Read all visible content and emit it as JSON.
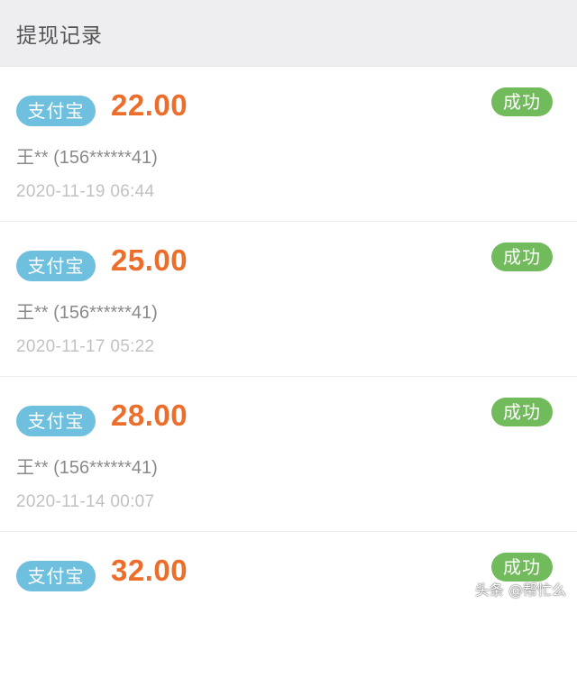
{
  "header": {
    "title": "提现记录"
  },
  "records": [
    {
      "method": "支付宝",
      "amount": "22.00",
      "status": "成功",
      "account": "王** (156******41)",
      "time": "2020-11-19 06:44"
    },
    {
      "method": "支付宝",
      "amount": "25.00",
      "status": "成功",
      "account": "王** (156******41)",
      "time": "2020-11-17 05:22"
    },
    {
      "method": "支付宝",
      "amount": "28.00",
      "status": "成功",
      "account": "王** (156******41)",
      "time": "2020-11-14 00:07"
    },
    {
      "method": "支付宝",
      "amount": "32.00",
      "status": "成功",
      "account": "",
      "time": ""
    }
  ],
  "watermark": "头条 @帮忙么",
  "colors": {
    "method_badge": "#6ec0de",
    "amount": "#ec6e2a",
    "status_success": "#72bb5c"
  }
}
